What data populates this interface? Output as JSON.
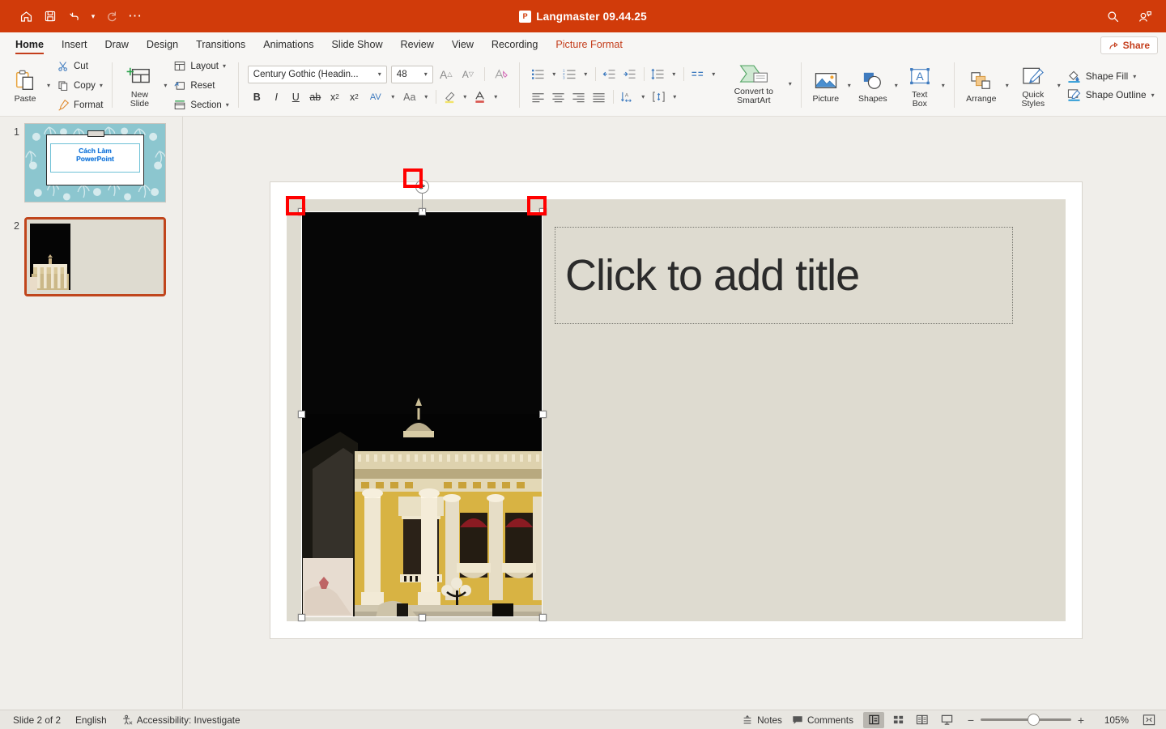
{
  "titlebar": {
    "title": "Langmaster 09.44.25",
    "app_badge": "P",
    "quick_access": [
      {
        "name": "home-icon",
        "label": "Home"
      },
      {
        "name": "save-icon",
        "label": "Save"
      },
      {
        "name": "undo-icon",
        "label": "Undo"
      },
      {
        "name": "redo-icon",
        "label": "Redo"
      },
      {
        "name": "more-options-icon",
        "label": "More"
      }
    ],
    "right_icons": [
      {
        "name": "search-icon",
        "label": "Search"
      },
      {
        "name": "account-icon",
        "label": "Account"
      }
    ]
  },
  "ribbon_tabs": [
    {
      "label": "Home",
      "state": "active"
    },
    {
      "label": "Insert",
      "state": "normal"
    },
    {
      "label": "Draw",
      "state": "normal"
    },
    {
      "label": "Design",
      "state": "normal"
    },
    {
      "label": "Transitions",
      "state": "normal"
    },
    {
      "label": "Animations",
      "state": "normal"
    },
    {
      "label": "Slide Show",
      "state": "normal"
    },
    {
      "label": "Review",
      "state": "normal"
    },
    {
      "label": "View",
      "state": "normal"
    },
    {
      "label": "Recording",
      "state": "normal"
    },
    {
      "label": "Picture Format",
      "state": "contextual"
    }
  ],
  "share": {
    "label": "Share"
  },
  "ribbon": {
    "clipboard": {
      "paste_label": "Paste",
      "cut_label": "Cut",
      "copy_label": "Copy",
      "format_label": "Format"
    },
    "slides": {
      "new_slide_label": "New\nSlide",
      "new_slide_line1": "New",
      "new_slide_line2": "Slide",
      "layout_label": "Layout",
      "reset_label": "Reset",
      "section_label": "Section"
    },
    "font": {
      "name": "Century Gothic (Headin...",
      "size": "48",
      "grow_label": "A",
      "shrink_label": "A",
      "clear_format_label": "A",
      "bold": "B",
      "italic": "I",
      "underline": "U",
      "strikethrough": "ab",
      "superscript": "x",
      "subscript": "x",
      "char_spacing": "AV",
      "change_case": "Aa",
      "highlight": "A",
      "font_color": "A"
    },
    "paragraph": {
      "bullets_label": "Bullets",
      "numbering_label": "Numbering",
      "decrease_indent_label": "Decrease Indent",
      "increase_indent_label": "Increase Indent",
      "line_spacing_label": "Line Spacing",
      "columns_label": "Columns",
      "align_left_label": "Align Left",
      "align_center_label": "Center",
      "align_right_label": "Align Right",
      "justify_label": "Justify",
      "text_direction_label": "Text Direction",
      "align_text_label": "Align Text",
      "convert_smartart_line1": "Convert to",
      "convert_smartart_line2": "SmartArt"
    },
    "drawing": {
      "picture_label": "Picture",
      "shapes_label": "Shapes",
      "textbox_line1": "Text",
      "textbox_line2": "Box",
      "arrange_label": "Arrange",
      "quickstyles_line1": "Quick",
      "quickstyles_line2": "Styles",
      "shape_fill_label": "Shape Fill",
      "shape_outline_label": "Shape Outline"
    }
  },
  "sidebar": {
    "slides": [
      {
        "number": "1",
        "selected": false,
        "title_line1": "Cách Làm",
        "title_line2": "PowerPoint"
      },
      {
        "number": "2",
        "selected": true,
        "title_line1": "",
        "title_line2": ""
      }
    ]
  },
  "canvas": {
    "title_placeholder": "Click to add title",
    "picture": {
      "name": "opera-house-night-photo",
      "selected": true,
      "rotate_handle_glyph": "⟳"
    },
    "highlight_color": "#ff0000"
  },
  "statusbar": {
    "slide_indicator": "Slide 2 of 2",
    "language": "English",
    "accessibility": "Accessibility: Investigate",
    "notes_label": "Notes",
    "comments_label": "Comments",
    "views": [
      {
        "name": "normal-view",
        "active": true
      },
      {
        "name": "slide-sorter-view",
        "active": false
      },
      {
        "name": "reading-view",
        "active": false
      },
      {
        "name": "slideshow-view",
        "active": false
      }
    ],
    "zoom_minus": "−",
    "zoom_plus": "+",
    "zoom_value": "105%",
    "fit_label": "Fit slide to window"
  },
  "colors": {
    "brand_red": "#d13b0a",
    "accent_red": "#c43e1c",
    "slide_bg": "#dedbd0",
    "app_bg": "#f0eeea"
  }
}
